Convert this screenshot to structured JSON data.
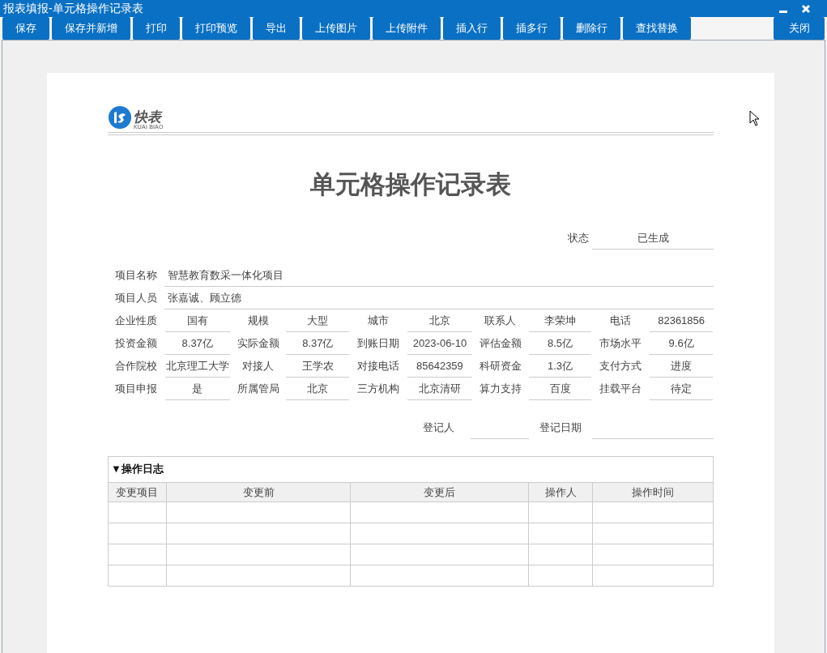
{
  "window": {
    "title": "报表填报-单元格操作记录表"
  },
  "toolbar": {
    "buttons": [
      "保存",
      "保存并新增",
      "打印",
      "打印预览",
      "导出",
      "上传图片",
      "上传附件",
      "插入行",
      "插多行",
      "删除行",
      "查找替换"
    ],
    "close_button": "关闭"
  },
  "logo": {
    "name": "快表",
    "subtitle": "KUAI BIAO"
  },
  "form": {
    "title": "单元格操作记录表",
    "status": {
      "label": "状态",
      "value": "已生成"
    },
    "wide_fields": [
      {
        "label": "项目名称",
        "value": "智慧教育数采一体化项目"
      },
      {
        "label": "项目人员",
        "value": "张嘉诚、顾立德"
      }
    ],
    "grid_rows": [
      [
        {
          "label": "企业性质",
          "value": "国有"
        },
        {
          "label": "规模",
          "value": "大型"
        },
        {
          "label": "城市",
          "value": "北京"
        },
        {
          "label": "联系人",
          "value": "李荣坤"
        },
        {
          "label": "电话",
          "value": "82361856"
        }
      ],
      [
        {
          "label": "投资金额",
          "value": "8.37亿"
        },
        {
          "label": "实际金额",
          "value": "8.37亿"
        },
        {
          "label": "到账日期",
          "value": "2023-06-10"
        },
        {
          "label": "评估金额",
          "value": "8.5亿"
        },
        {
          "label": "市场水平",
          "value": "9.6亿"
        }
      ],
      [
        {
          "label": "合作院校",
          "value": "北京理工大学"
        },
        {
          "label": "对接人",
          "value": "王学农"
        },
        {
          "label": "对接电话",
          "value": "85642359"
        },
        {
          "label": "科研资金",
          "value": "1.3亿"
        },
        {
          "label": "支付方式",
          "value": "进度"
        }
      ],
      [
        {
          "label": "项目申报",
          "value": "是"
        },
        {
          "label": "所属管局",
          "value": "北京"
        },
        {
          "label": "三方机构",
          "value": "北京清研"
        },
        {
          "label": "算力支持",
          "value": "百度"
        },
        {
          "label": "挂载平台",
          "value": "待定"
        }
      ]
    ],
    "signoff": [
      {
        "label": "登记人"
      },
      {
        "label": "登记日期"
      }
    ]
  },
  "log": {
    "toggle": "▼",
    "title": "操作日志",
    "columns": [
      "变更项目",
      "变更前",
      "变更后",
      "操作人",
      "操作时间"
    ]
  }
}
